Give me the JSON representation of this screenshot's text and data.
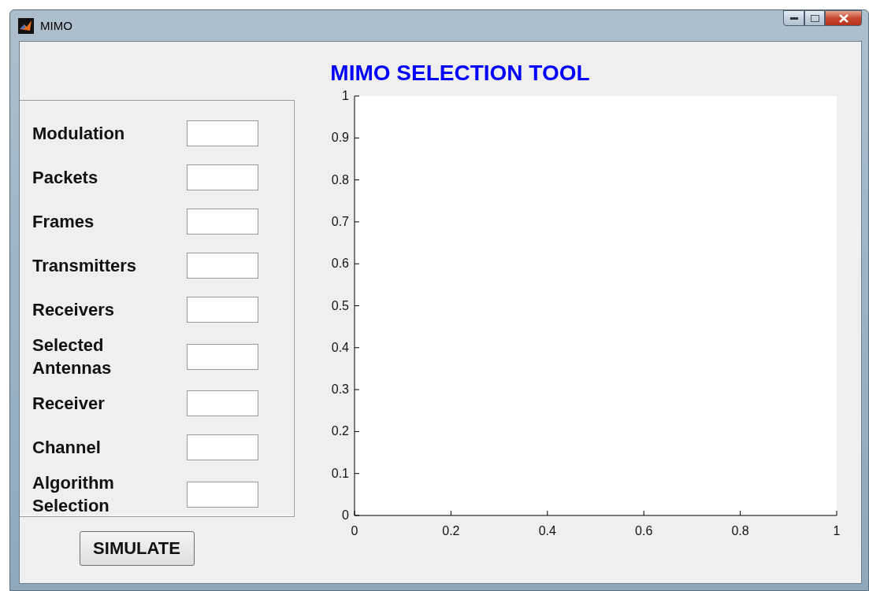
{
  "window": {
    "title": "MIMO"
  },
  "heading": "MIMO SELECTION TOOL",
  "fields": [
    {
      "label": "Modulation"
    },
    {
      "label": "Packets"
    },
    {
      "label": "Frames"
    },
    {
      "label": "Transmitters"
    },
    {
      "label": "Receivers"
    },
    {
      "label": "Selected Antennas"
    },
    {
      "label": "Receiver"
    },
    {
      "label": "Channel"
    },
    {
      "label": "Algorithm Selection"
    }
  ],
  "simulate_button": "SIMULATE",
  "axes": {
    "chart_data": {
      "type": "line",
      "xlim": [
        0,
        1
      ],
      "ylim": [
        0,
        1
      ],
      "xticks": [
        0,
        0.2,
        0.4,
        0.6,
        0.8,
        1
      ],
      "yticks": [
        0,
        0.1,
        0.2,
        0.3,
        0.4,
        0.5,
        0.6,
        0.7,
        0.8,
        0.9,
        1
      ]
    }
  }
}
